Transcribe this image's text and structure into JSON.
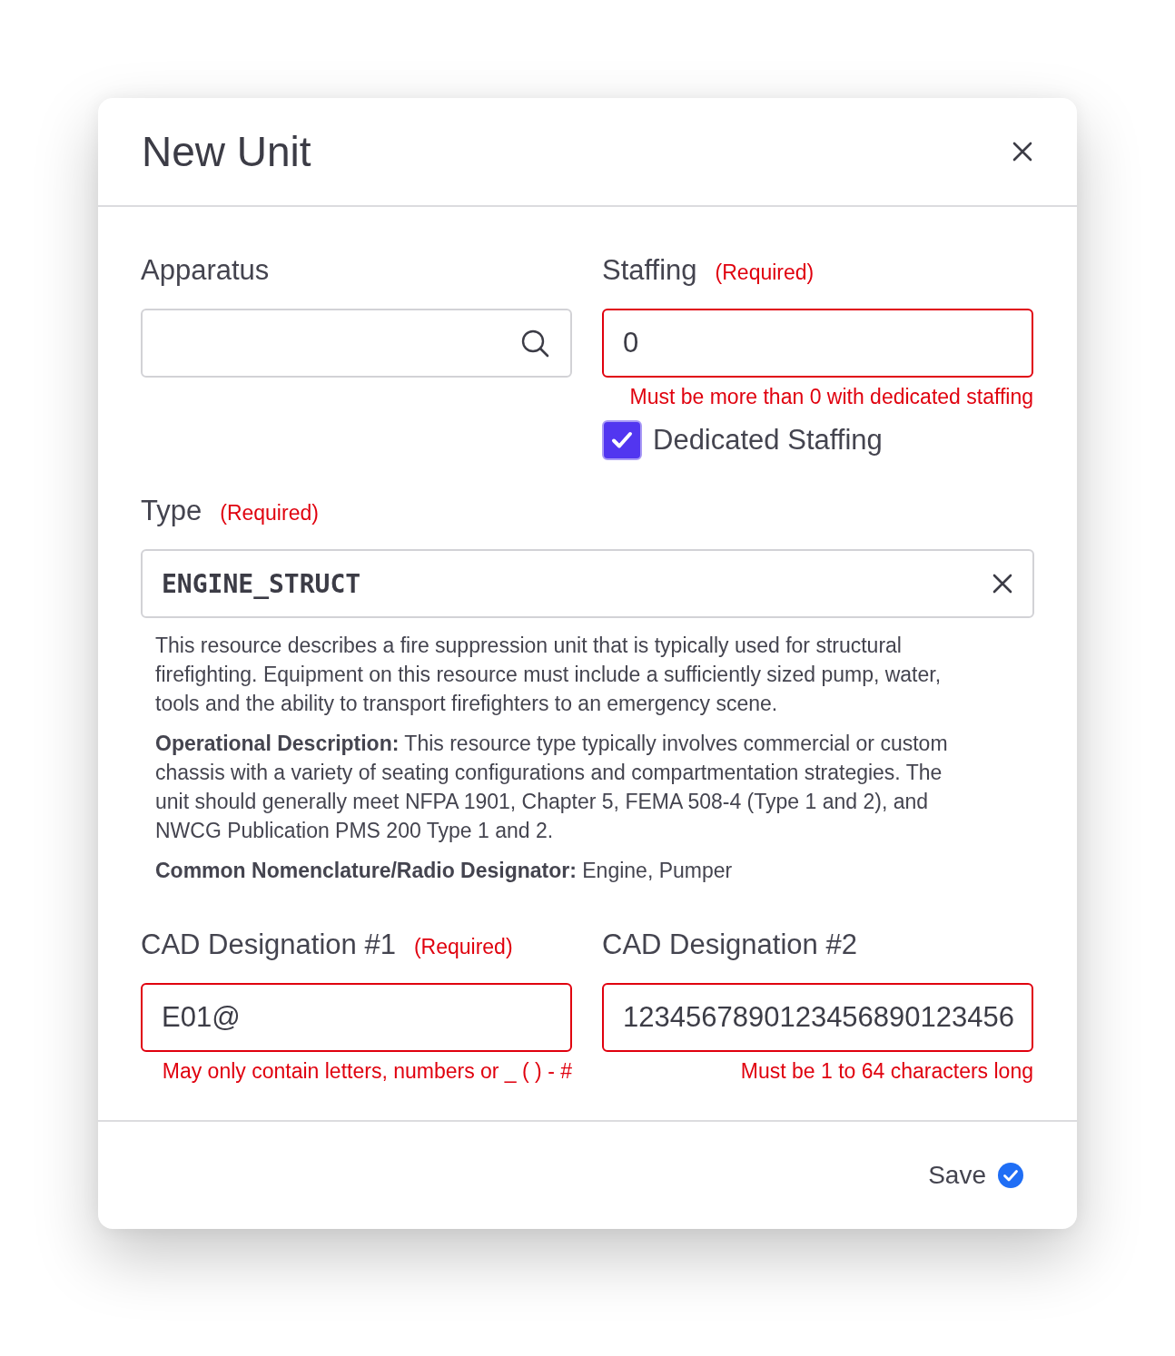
{
  "dialog": {
    "title": "New Unit"
  },
  "apparatus": {
    "label": "Apparatus"
  },
  "staffing": {
    "label": "Staffing",
    "required": "(Required)",
    "value": "0",
    "invalid": true,
    "error": "Must be more than 0 with dedicated staffing"
  },
  "dedicated_staffing": {
    "label": "Dedicated Staffing",
    "checked": true
  },
  "type": {
    "label": "Type",
    "required": "(Required)",
    "value": "ENGINE_STRUCT",
    "paragraphs": [
      "This resource describes a fire suppression unit that is typically used for structural firefighting. Equipment on this resource must include a sufficiently sized pump, water, tools and the ability to transport firefighters to an emergency scene.",
      "**Operational Description:** This resource type typically involves commercial or custom chassis with a variety of seating configurations and compartmentation strategies. The unit should generally meet NFPA 1901, Chapter 5, FEMA 508-4 (Type 1 and 2), and NWCG Publication PMS 200 Type 1 and 2.",
      "**Common Nomenclature/Radio Designator:** Engine, Pumper"
    ]
  },
  "cad_fields": [
    {
      "label": "CAD Designation #1",
      "required": "(Required)",
      "value": "E01@",
      "invalid": true,
      "error": "May only contain letters, numbers or _ ( ) - #"
    },
    {
      "label": "CAD Designation #2",
      "value": "1234567890123456890123456",
      "invalid": true,
      "error": "Must be 1 to 64 characters long"
    }
  ],
  "footer": {
    "save": "Save"
  }
}
